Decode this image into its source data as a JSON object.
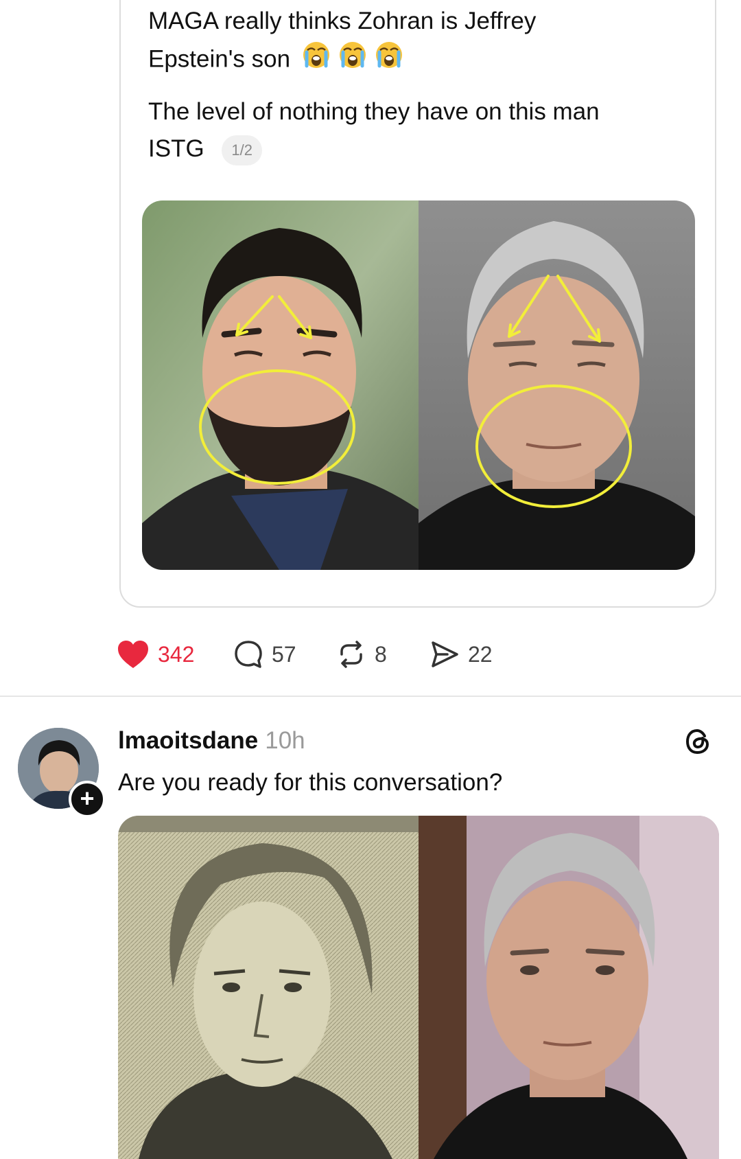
{
  "quoted_post": {
    "line1": "MAGA really thinks Zohran is Jeffrey",
    "line2": "Epstein's son",
    "emoji": "😭😭😭",
    "line3": "The level of nothing they have on this man",
    "line4": "ISTG",
    "carousel_indicator": "1/2"
  },
  "actions": {
    "likes": "342",
    "comments": "57",
    "reposts": "8",
    "shares": "22"
  },
  "post": {
    "username": "lmaoitsdane",
    "timestamp": "10h",
    "text": "Are you ready for this conversation?",
    "follow_symbol": "+"
  },
  "colors": {
    "like_red": "#e8283e",
    "annotation_yellow": "#f2ee3a",
    "divider": "#e6e6e6"
  },
  "icons": {
    "like": "heart-icon",
    "comment": "comment-bubble-icon",
    "repost": "repost-icon",
    "share": "send-icon",
    "app": "threads-logo-icon"
  }
}
